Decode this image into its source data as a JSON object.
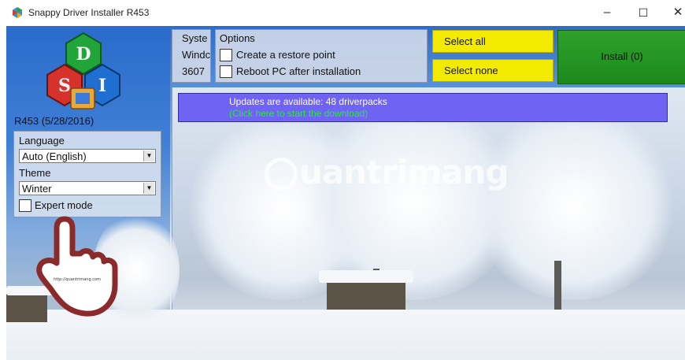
{
  "window": {
    "title": "Snappy Driver Installer R453",
    "minimize_glyph": "–",
    "maximize_glyph": "☐",
    "close_glyph": "✕"
  },
  "logo": {
    "letters": [
      "D",
      "S",
      "I"
    ]
  },
  "version": "R453 (5/28/2016)",
  "system_panel": {
    "lines": [
      "Syste",
      "Windc",
      "3607"
    ]
  },
  "options": {
    "header": "Options",
    "restore_point": {
      "label": "Create a restore point",
      "checked": false
    },
    "reboot": {
      "label": "Reboot PC after installation",
      "checked": false
    }
  },
  "buttons": {
    "select_all": "Select all",
    "select_none": "Select none",
    "install": "Install (0)"
  },
  "notice": {
    "line1": "Updates are available: 48 driverpacks",
    "line2": "(Click here to start the download)"
  },
  "settings": {
    "language_label": "Language",
    "language_value": "Auto (English)",
    "theme_label": "Theme",
    "theme_value": "Winter",
    "expert_mode_label": "Expert mode",
    "expert_mode_checked": false
  },
  "watermark": "uantrimang",
  "hand_caption": "http://quantrimang.com",
  "icons": {
    "app": "sdi-logo-icon",
    "dropdown": "dropdown-arrow-icon"
  },
  "colors": {
    "select_buttons": "#f2ea00",
    "install_button": "#1f8f1f",
    "notice_bg": "#6f63f3",
    "notice_link": "#2fe44a"
  }
}
